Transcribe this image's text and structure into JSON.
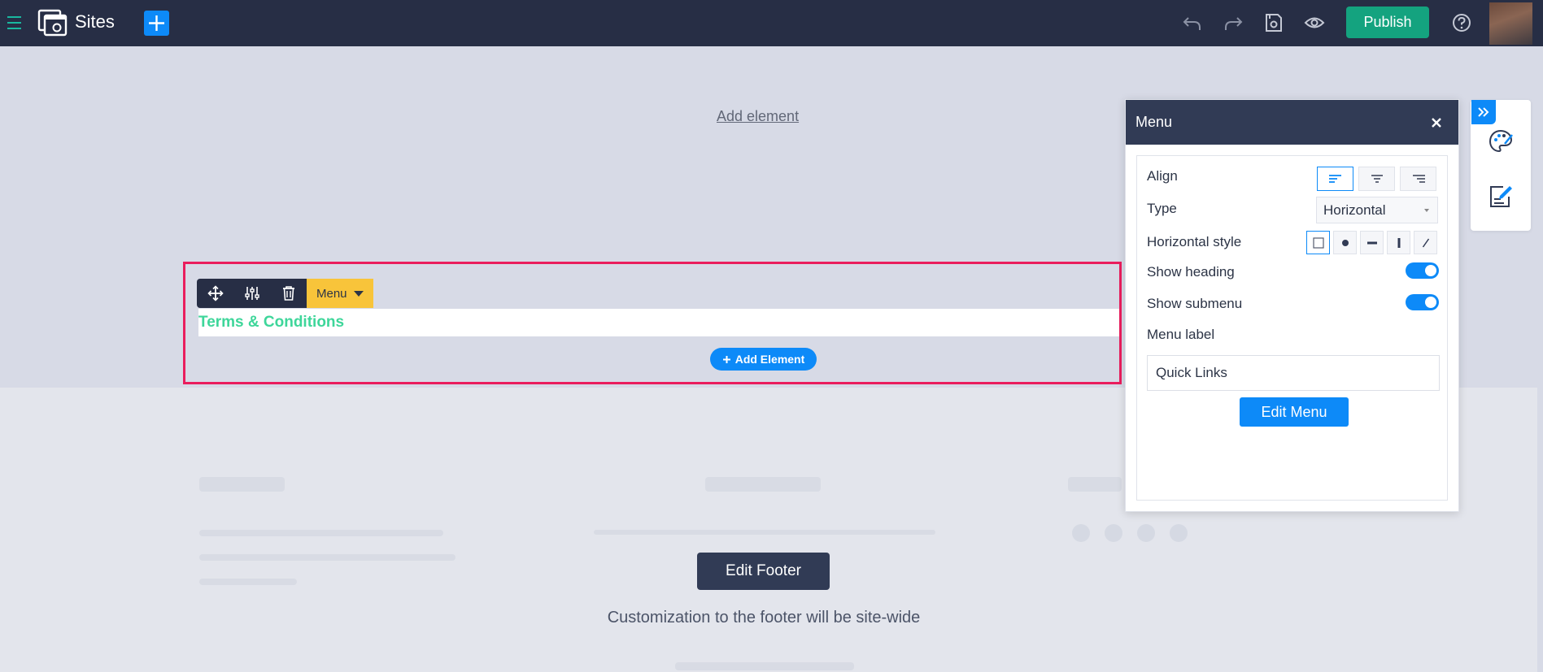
{
  "topbar": {
    "app_title": "Sites",
    "publish_label": "Publish"
  },
  "canvas": {
    "add_element_link": "Add element",
    "menu_toolbar_label": "Menu",
    "menu_items": [
      "Terms & Conditions"
    ],
    "add_element_button": "Add Element"
  },
  "footer": {
    "edit_footer_label": "Edit Footer",
    "note": "Customization to the footer will be site-wide"
  },
  "panel": {
    "title": "Menu",
    "align_label": "Align",
    "type_label": "Type",
    "type_value": "Horizontal",
    "horizontal_style_label": "Horizontal style",
    "show_heading_label": "Show heading",
    "show_heading_on": true,
    "show_submenu_label": "Show submenu",
    "show_submenu_on": true,
    "menu_label_label": "Menu label",
    "menu_label_value": "Quick Links",
    "edit_menu_label": "Edit Menu"
  },
  "colors": {
    "topbar": "#272e45",
    "accent": "#0d8af8",
    "publish": "#14a37f",
    "selection": "#ea1d5d",
    "toolbar_label": "#f8c43a",
    "menu_link": "#3ed69a"
  },
  "icons": {
    "topbar": [
      "hamburger-icon",
      "sites-logo-icon",
      "plus-icon",
      "undo-icon",
      "redo-icon",
      "save-icon",
      "preview-eye-icon",
      "help-icon"
    ],
    "toolbar": [
      "move-icon",
      "settings-sliders-icon",
      "trash-icon"
    ],
    "rail": [
      "double-chevron-right-icon",
      "palette-icon",
      "edit-note-icon"
    ]
  }
}
